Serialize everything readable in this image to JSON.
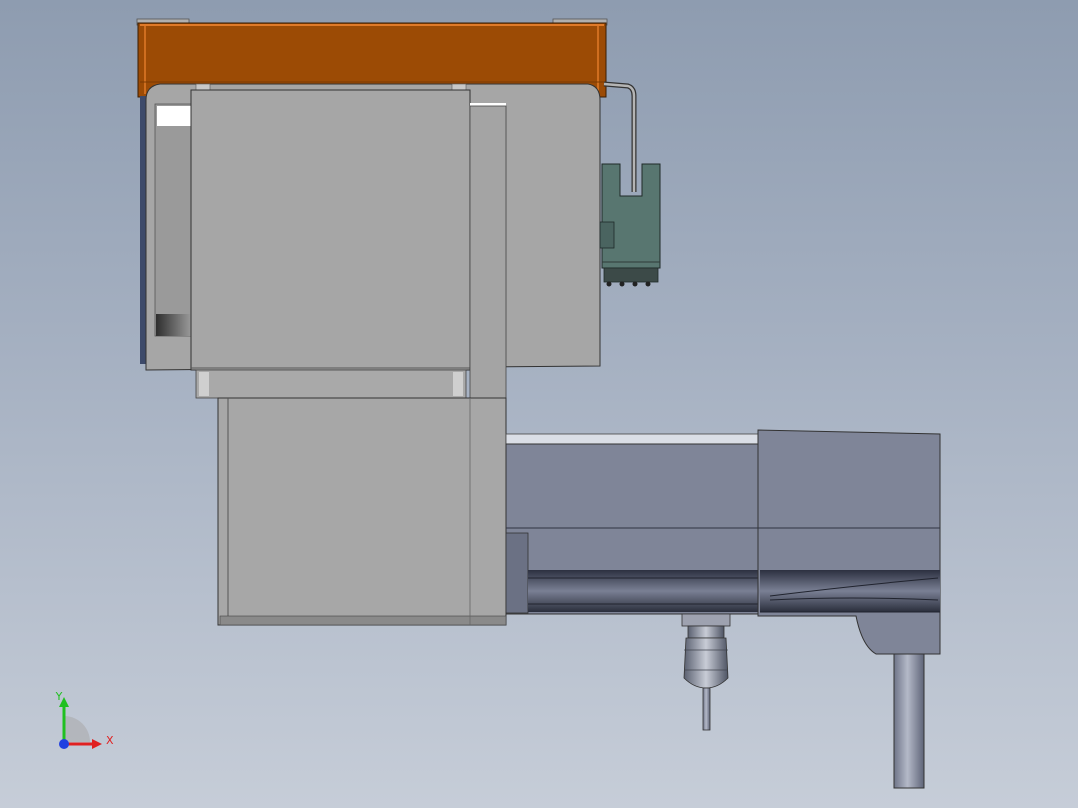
{
  "viewport": {
    "background_top": "#8e9cb0",
    "background_bottom": "#c6cdd8"
  },
  "model": {
    "top_plate_color": "#9c4b05",
    "top_plate_highlight": "#e07a28",
    "housing_color": "#a6a6a6",
    "slide_body_color": "#7f8598",
    "connector_color": "#587670"
  },
  "triad": {
    "x_label": "X",
    "y_label": "Y",
    "x_color": "#e02020",
    "y_color": "#20c020",
    "z_color": "#2040e0"
  }
}
